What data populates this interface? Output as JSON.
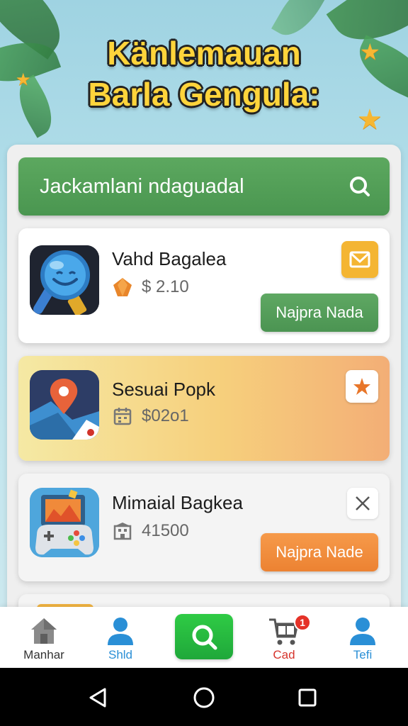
{
  "headline": {
    "line1": "Känlemauan",
    "line2": "Barla Gengula:"
  },
  "search": {
    "text": "Jackamlani ndaguadal",
    "icon": "search-icon"
  },
  "apps": [
    {
      "name": "Vahd Bagalea",
      "price": "$ 2.10",
      "price_icon": "gem-icon",
      "corner_icon": "mail-icon",
      "action": "Najpra Nada"
    },
    {
      "name": "Sesuai Popk",
      "price": "$02o1",
      "price_icon": "calendar-icon",
      "corner_icon": "star-icon",
      "action": ""
    },
    {
      "name": "Mimaial Bagkea",
      "price": "41500",
      "price_icon": "building-icon",
      "corner_icon": "close-icon",
      "action": "Najpra Nade"
    }
  ],
  "bottom_nav": {
    "home": "Manhar",
    "shld": "Shld",
    "cart": "Cad",
    "cart_badge": "1",
    "tefi": "Tefi"
  },
  "colors": {
    "accent_green": "#4e9a53",
    "accent_orange": "#ef8a3a",
    "headline_yellow": "#ffd43b",
    "nav_blue": "#2a8fd6",
    "nav_red": "#d6342c"
  }
}
